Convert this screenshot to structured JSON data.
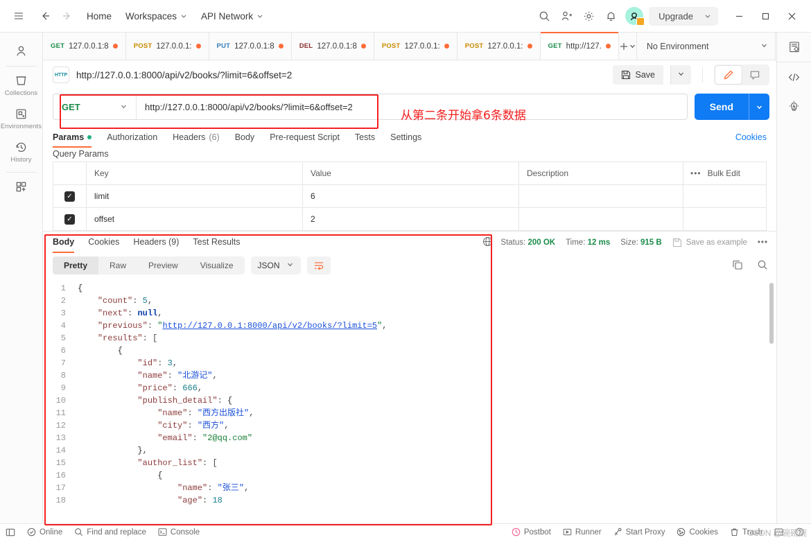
{
  "topbar": {
    "hamburger_icon": "hamburger-icon",
    "back_icon": "arrow-left-icon",
    "forward_icon": "arrow-right-icon",
    "home": "Home",
    "workspaces": "Workspaces",
    "api_network": "API Network",
    "search_icon": "search-icon",
    "invite_icon": "invite-user-icon",
    "settings_icon": "gear-icon",
    "notifications_icon": "bell-icon",
    "avatar_icon": "avatar",
    "upgrade": "Upgrade",
    "minimize": "–",
    "maximize": "□",
    "close": "✕"
  },
  "rail": {
    "items": [
      {
        "label": "",
        "icon": "user-icon"
      },
      {
        "label": "Collections",
        "icon": "collections-icon"
      },
      {
        "label": "Environments",
        "icon": "environments-icon"
      },
      {
        "label": "History",
        "icon": "history-icon"
      },
      {
        "label": "",
        "icon": "add-apps-icon"
      }
    ]
  },
  "right_rail": {
    "items": [
      {
        "icon": "environment-quick-look-icon"
      },
      {
        "icon": "code-snippet-icon"
      },
      {
        "icon": "lightbulb-icon"
      }
    ]
  },
  "tabs": {
    "items": [
      {
        "method": "GET",
        "label": "127.0.0.1:8",
        "dirty": true,
        "active": false
      },
      {
        "method": "POST",
        "label": "127.0.0.1:",
        "dirty": true,
        "active": false
      },
      {
        "method": "PUT",
        "label": "127.0.0.1:8",
        "dirty": true,
        "active": false
      },
      {
        "method": "DEL",
        "label": "127.0.0.1:8",
        "dirty": true,
        "active": false
      },
      {
        "method": "POST",
        "label": "127.0.0.1:",
        "dirty": true,
        "active": false
      },
      {
        "method": "POST",
        "label": "127.0.0.1:",
        "dirty": true,
        "active": false
      },
      {
        "method": "GET",
        "label": "http://127.",
        "dirty": true,
        "active": true
      }
    ],
    "add_label": "+",
    "environment": "No Environment"
  },
  "request": {
    "protocol_badge": "HTTP",
    "title": "http://127.0.0.1:8000/api/v2/books/?limit=6&offset=2",
    "save_label": "Save",
    "method": "GET",
    "url": "http://127.0.0.1:8000/api/v2/books/?limit=6&offset=2",
    "send_label": "Send",
    "tabs": [
      {
        "label": "Params",
        "dot": true,
        "active": true
      },
      {
        "label": "Authorization",
        "dot": false,
        "active": false
      },
      {
        "label": "Headers",
        "count": "(6)",
        "dot": false,
        "active": false
      },
      {
        "label": "Body",
        "dot": false,
        "active": false
      },
      {
        "label": "Pre-request Script",
        "dot": false,
        "active": false
      },
      {
        "label": "Tests",
        "dot": false,
        "active": false
      },
      {
        "label": "Settings",
        "dot": false,
        "active": false
      }
    ],
    "cookies_link": "Cookies"
  },
  "query_params": {
    "section_title": "Query Params",
    "columns": [
      "Key",
      "Value",
      "Description"
    ],
    "bulk_edit": "Bulk Edit",
    "rows": [
      {
        "checked": true,
        "key": "limit",
        "value": "6",
        "description": ""
      },
      {
        "checked": true,
        "key": "offset",
        "value": "2",
        "description": ""
      }
    ]
  },
  "response": {
    "tabs": [
      {
        "label": "Body",
        "active": true
      },
      {
        "label": "Cookies",
        "active": false
      },
      {
        "label": "Headers (9)",
        "active": false
      },
      {
        "label": "Test Results",
        "active": false
      }
    ],
    "status_label": "Status:",
    "status_value": "200 OK",
    "time_label": "Time:",
    "time_value": "12 ms",
    "size_label": "Size:",
    "size_value": "915 B",
    "save_as_example": "Save as example",
    "more": "•••",
    "format_tabs": [
      {
        "label": "Pretty",
        "active": true
      },
      {
        "label": "Raw",
        "active": false
      },
      {
        "label": "Preview",
        "active": false
      },
      {
        "label": "Visualize",
        "active": false
      }
    ],
    "language": "JSON",
    "wrap_icon": "wrap-lines-icon",
    "copy_icon": "copy-icon",
    "search_icon": "search-icon"
  },
  "body_json": {
    "count": 5,
    "next": null,
    "previous": "http://127.0.0.1:8000/api/v2/books/?limit=5",
    "results": [
      {
        "id": 3,
        "name": "北游记",
        "price": 666,
        "publish_detail": {
          "name": "西方出版社",
          "city": "西方",
          "email": "2@qq.com"
        },
        "author_list": [
          {
            "name": "张三",
            "age": 18
          }
        ]
      }
    ]
  },
  "body_lines": [
    {
      "n": 1,
      "html": "{"
    },
    {
      "n": 2,
      "html": "    <span class='k'>\"count\"</span><span class='p'>:</span> <span class='n'>5</span><span class='p'>,</span>"
    },
    {
      "n": 3,
      "html": "    <span class='k'>\"next\"</span><span class='p'>:</span> <span class='nul'>null</span><span class='p'>,</span>"
    },
    {
      "n": 4,
      "html": "    <span class='k'>\"previous\"</span><span class='p'>:</span> <span class='s'>\"</span><span class='lnk'>http://127.0.0.1:8000/api/v2/books/?limit=5</span><span class='s'>\"</span><span class='p'>,</span>"
    },
    {
      "n": 5,
      "html": "    <span class='k'>\"results\"</span><span class='p'>:</span> <span class='p'>[</span>"
    },
    {
      "n": 6,
      "html": "        {"
    },
    {
      "n": 7,
      "html": "            <span class='k'>\"id\"</span><span class='p'>:</span> <span class='n'>3</span><span class='p'>,</span>"
    },
    {
      "n": 8,
      "html": "            <span class='k'>\"name\"</span><span class='p'>:</span> <span class='cjk'>\"北游记\"</span><span class='p'>,</span>"
    },
    {
      "n": 9,
      "html": "            <span class='k'>\"price\"</span><span class='p'>:</span> <span class='n'>666</span><span class='p'>,</span>"
    },
    {
      "n": 10,
      "html": "            <span class='k'>\"publish_detail\"</span><span class='p'>:</span> {"
    },
    {
      "n": 11,
      "html": "                <span class='k'>\"name\"</span><span class='p'>:</span> <span class='cjk'>\"西方出版社\"</span><span class='p'>,</span>"
    },
    {
      "n": 12,
      "html": "                <span class='k'>\"city\"</span><span class='p'>:</span> <span class='cjk'>\"西方\"</span><span class='p'>,</span>"
    },
    {
      "n": 13,
      "html": "                <span class='k'>\"email\"</span><span class='p'>:</span> <span class='s'>\"2@qq.com\"</span>"
    },
    {
      "n": 14,
      "html": "            }<span class='p'>,</span>"
    },
    {
      "n": 15,
      "html": "            <span class='k'>\"author_list\"</span><span class='p'>:</span> <span class='p'>[</span>"
    },
    {
      "n": 16,
      "html": "                {"
    },
    {
      "n": 17,
      "html": "                    <span class='k'>\"name\"</span><span class='p'>:</span> <span class='cjk'>\"张三\"</span><span class='p'>,</span>"
    },
    {
      "n": 18,
      "html": "                    <span class='k'>\"age\"</span><span class='p'>:</span> <span class='n'>18</span>"
    }
  ],
  "footer": {
    "left": [
      {
        "label": "",
        "icon": "sidebar-toggle-icon"
      },
      {
        "label": "Online",
        "icon": "online-icon"
      },
      {
        "label": "Find and replace",
        "icon": "search-icon"
      },
      {
        "label": "Console",
        "icon": "console-icon"
      }
    ],
    "right": [
      {
        "label": "Postbot",
        "icon": "postbot-icon"
      },
      {
        "label": "Runner",
        "icon": "runner-icon"
      },
      {
        "label": "Start Proxy",
        "icon": "proxy-icon"
      },
      {
        "label": "Cookies",
        "icon": "cookies-icon"
      },
      {
        "label": "Trash",
        "icon": "trash-icon"
      },
      {
        "label": "",
        "icon": "panel-icon"
      },
      {
        "label": "",
        "icon": "help-icon"
      }
    ],
    "watermark": "CSDN @碗碗碗"
  },
  "annotations": {
    "url_note": "从第二条开始拿6条数据"
  },
  "colors": {
    "accent": "#ff6c37",
    "send": "#0f7bf4",
    "get": "#1a8c4a",
    "annotation": "#f42020",
    "link": "#0f7bf4"
  }
}
